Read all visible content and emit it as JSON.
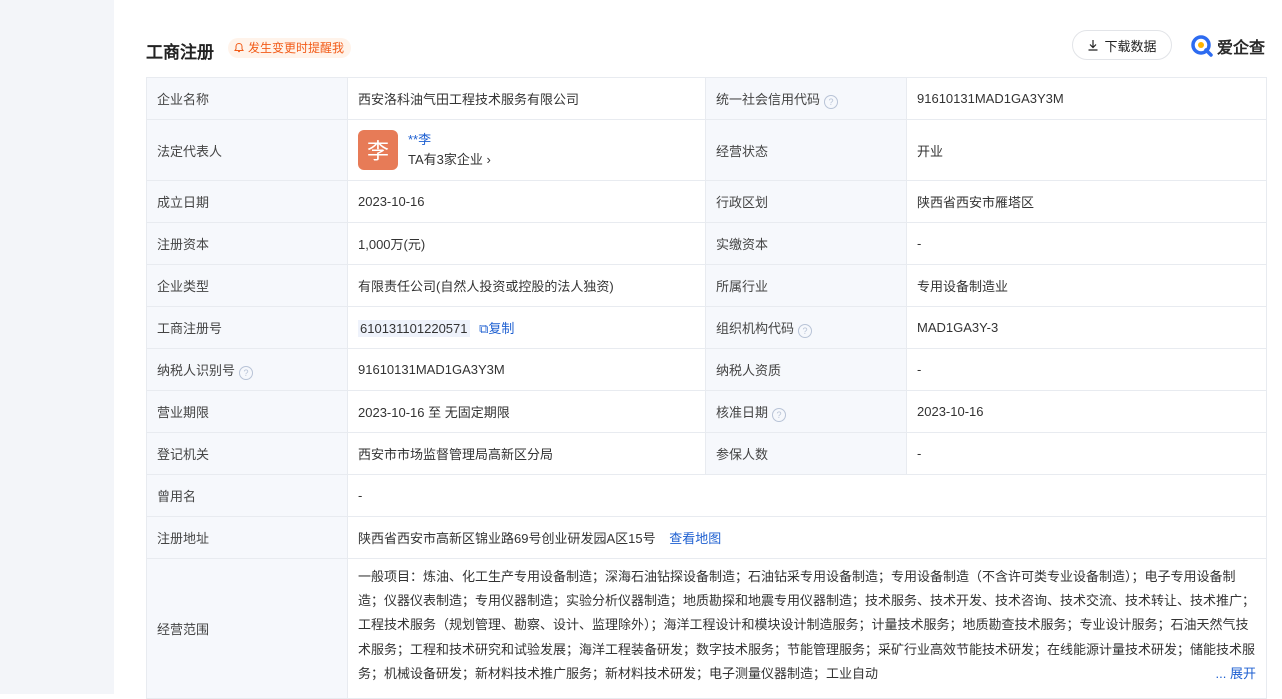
{
  "header": {
    "title": "工商注册",
    "remind_label": "发生变更时提醒我",
    "download_label": "下载数据",
    "brand_name": "爱企查"
  },
  "rows": {
    "company_name": {
      "label": "企业名称",
      "value": "西安洛科油气田工程技术服务有限公司"
    },
    "credit_code": {
      "label": "统一社会信用代码",
      "value": "91610131MAD1GA3Y3M"
    },
    "legal_rep": {
      "label": "法定代表人",
      "avatar_char": "李",
      "name": "**李",
      "count_text": "TA有3家企业"
    },
    "status": {
      "label": "经营状态",
      "value": "开业"
    },
    "found_date": {
      "label": "成立日期",
      "value": "2023-10-16"
    },
    "region": {
      "label": "行政区划",
      "value": "陕西省西安市雁塔区"
    },
    "reg_capital": {
      "label": "注册资本",
      "value": "1,000万(元)"
    },
    "paid_capital": {
      "label": "实缴资本",
      "value": "-"
    },
    "company_type": {
      "label": "企业类型",
      "value": "有限责任公司(自然人投资或控股的法人独资)"
    },
    "industry": {
      "label": "所属行业",
      "value": "专用设备制造业"
    },
    "reg_no": {
      "label": "工商注册号",
      "value": "610131101220571",
      "copy_label": "复制"
    },
    "org_code": {
      "label": "组织机构代码",
      "value": "MAD1GA3Y-3"
    },
    "taxpayer_id": {
      "label": "纳税人识别号",
      "value": "91610131MAD1GA3Y3M"
    },
    "taxpayer_qual": {
      "label": "纳税人资质",
      "value": "-"
    },
    "business_term": {
      "label": "营业期限",
      "value": "2023-10-16 至 无固定期限"
    },
    "approve_date": {
      "label": "核准日期",
      "value": "2023-10-16"
    },
    "authority": {
      "label": "登记机关",
      "value": "西安市市场监督管理局高新区分局"
    },
    "insured": {
      "label": "参保人数",
      "value": "-"
    },
    "former_name": {
      "label": "曾用名",
      "value": "-"
    },
    "address": {
      "label": "注册地址",
      "value": "陕西省西安市高新区锦业路69号创业研发园A区15号",
      "map_label": "查看地图"
    },
    "scope": {
      "label": "经营范围",
      "value": "一般项目：炼油、化工生产专用设备制造；深海石油钻探设备制造；石油钻采专用设备制造；专用设备制造（不含许可类专业设备制造）；电子专用设备制造；仪器仪表制造；专用仪器制造；实验分析仪器制造；地质勘探和地震专用仪器制造；技术服务、技术开发、技术咨询、技术交流、技术转让、技术推广；工程技术服务（规划管理、勘察、设计、监理除外）；海洋工程设计和模块设计制造服务；计量技术服务；地质勘查技术服务；专业设计服务；石油天然气技术服务；工程和技术研究和试验发展；海洋工程装备研发；数字技术服务；节能管理服务；采矿行业高效节能技术研发；在线能源计量技术研发；储能技术服务；机械设备研发；新材料技术推广服务；新材料技术研发；电子测量仪器制造；工业自动",
      "expand_label": "... 展开"
    }
  },
  "colors": {
    "link": "#1d5fd1",
    "remind": "#f25c19",
    "avatar": "#e77b57",
    "label_bg": "#f6f8fc"
  }
}
